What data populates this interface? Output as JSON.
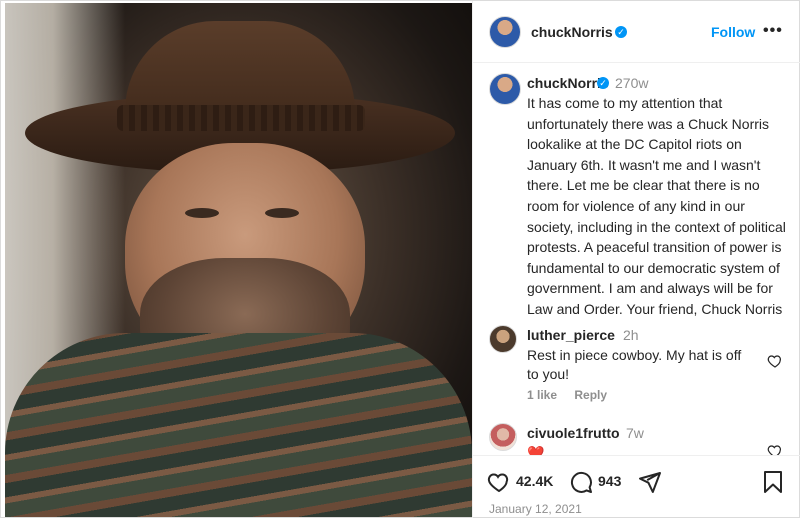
{
  "post": {
    "author": "chuckNorris",
    "verified_badge": "✓",
    "follow_label": "Follow",
    "more_label": "•••",
    "caption": {
      "username": "chuckNorris",
      "timestamp": "270w",
      "text": "It has come to my attention that unfortunately there was a Chuck Norris lookalike at the DC Capitol riots on January 6th. It wasn't me and I wasn't there. Let me be clear that there is no room for violence of any kind in our society, including in the context of political protests. A peaceful transition of power is fundamental to our democratic system of government. I am and always will be for Law and Order. Your friend, Chuck Norris"
    },
    "comments": [
      {
        "username": "luther_pierce",
        "timestamp": "2h",
        "text": "Rest in piece cowboy. My hat is off to you!",
        "likes": "1 like",
        "reply_label": "Reply"
      },
      {
        "username": "civuole1frutto",
        "timestamp": "7w",
        "text": "❤️"
      }
    ],
    "actions": {
      "like_count": "42.4K",
      "comment_count": "943",
      "date": "January 12, 2021"
    },
    "icons": [
      "verified-badge-icon",
      "more-options-icon",
      "heart-icon",
      "comment-icon",
      "share-icon",
      "bookmark-icon"
    ],
    "colors": {
      "accent": "#0095f6",
      "text": "#262626",
      "muted": "#8e8e8e",
      "heart": "#ed4956"
    }
  }
}
